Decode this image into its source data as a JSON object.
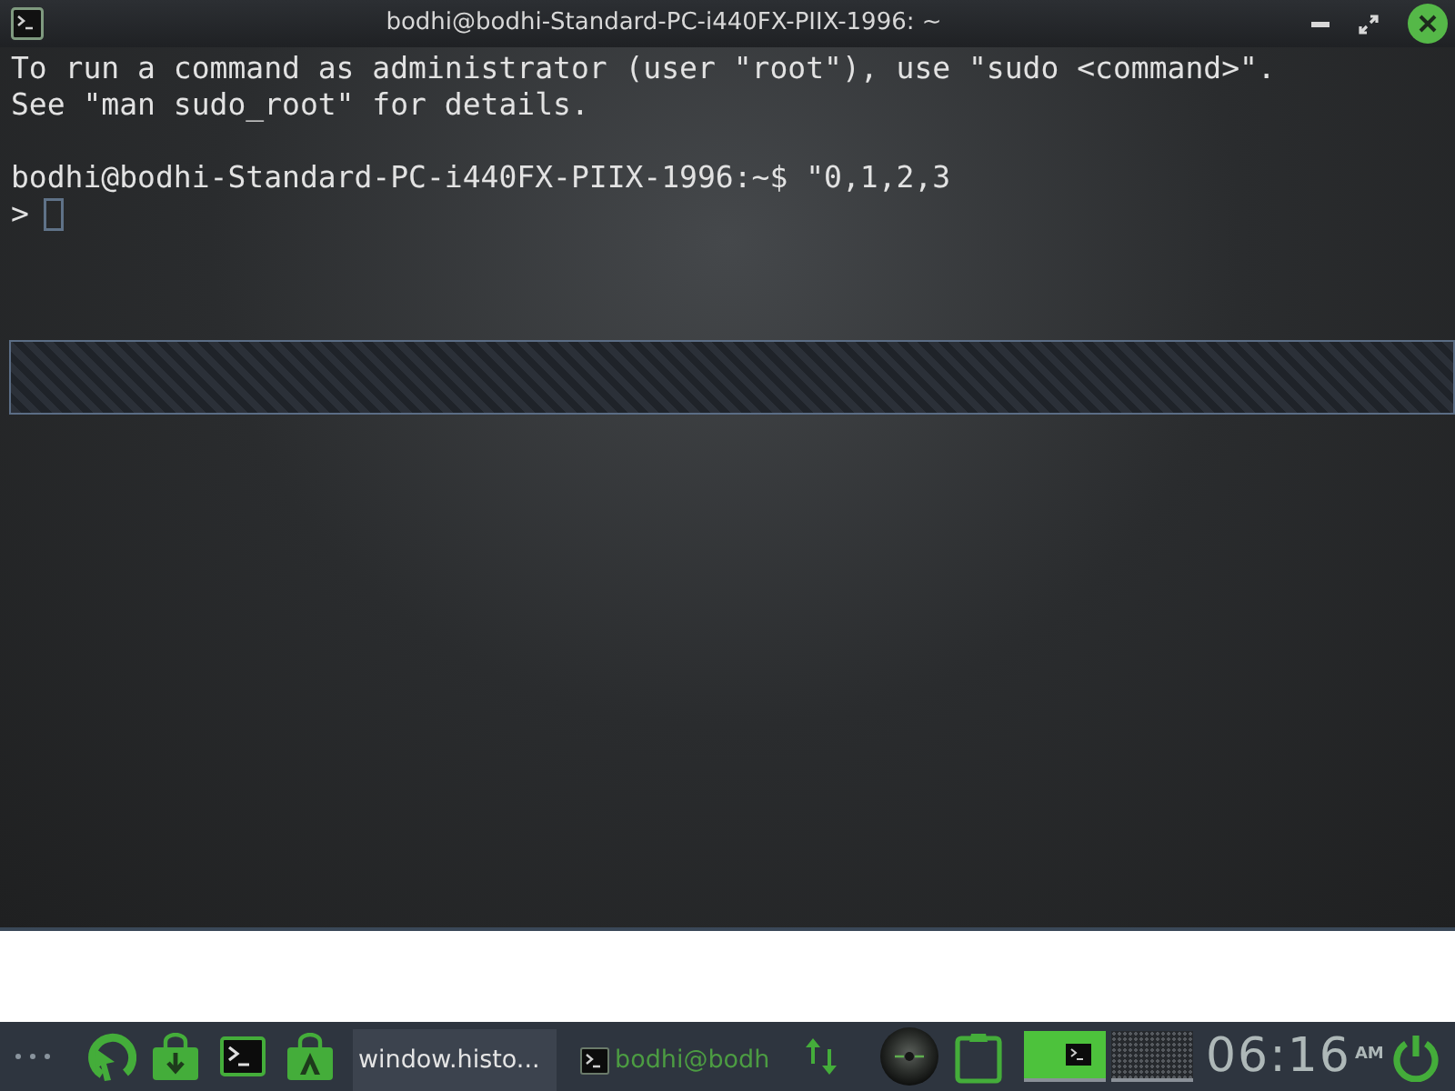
{
  "window": {
    "title": "bodhi@bodhi-Standard-PC-i440FX-PIIX-1996: ~"
  },
  "terminal": {
    "output": [
      "To run a command as administrator (user \"root\"), use \"sudo <command>\".",
      "See \"man sudo_root\" for details."
    ],
    "prompt": "bodhi@bodhi-Standard-PC-i440FX-PIIX-1996:~$",
    "command": "\"0,1,2,3",
    "continuation_prompt": ">"
  },
  "taskbar": {
    "tasks": [
      {
        "label": "window.histo...",
        "selected": true
      },
      {
        "label": "bodhi@bodh",
        "selected": false
      }
    ],
    "desktops": [
      {
        "selected": true,
        "kind": "occupied"
      },
      {
        "selected": false,
        "kind": "empty"
      }
    ],
    "clock": {
      "time": "06:16",
      "period": "AM"
    }
  }
}
